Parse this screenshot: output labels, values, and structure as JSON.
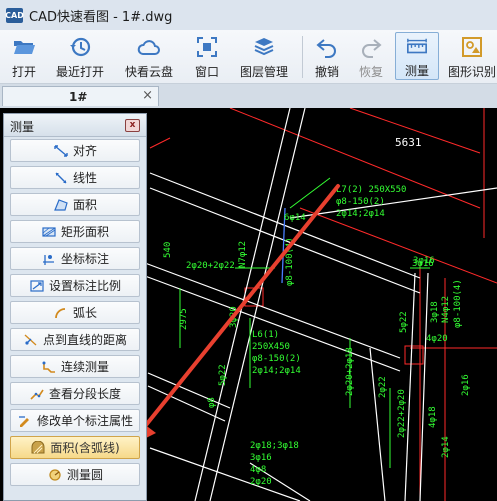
{
  "window": {
    "title": "CAD快速看图 - 1#.dwg",
    "logo_text": "CAD"
  },
  "toolbar": {
    "items": [
      {
        "label": "打开",
        "icon": "folder-open-icon"
      },
      {
        "label": "最近打开",
        "icon": "history-icon"
      },
      {
        "label": "快看云盘",
        "icon": "cloud-icon"
      },
      {
        "label": "窗口",
        "icon": "window-icon"
      },
      {
        "label": "图层管理",
        "icon": "layers-icon"
      },
      {
        "label": "撤销",
        "icon": "undo-icon"
      },
      {
        "label": "恢复",
        "icon": "redo-icon",
        "disabled": true
      },
      {
        "label": "测量",
        "icon": "ruler-icon",
        "active": true
      },
      {
        "label": "图形识别",
        "icon": "shape-recognize-icon"
      }
    ]
  },
  "tabs": [
    {
      "label": "1#",
      "close": "×"
    }
  ],
  "measure_panel": {
    "title": "测量",
    "close": "x",
    "items": [
      {
        "label": "对齐",
        "icon": "align-measure-icon"
      },
      {
        "label": "线性",
        "icon": "linear-measure-icon"
      },
      {
        "label": "面积",
        "icon": "area-icon"
      },
      {
        "label": "矩形面积",
        "icon": "rect-area-icon"
      },
      {
        "label": "坐标标注",
        "icon": "coordinate-icon"
      },
      {
        "label": "设置标注比例",
        "icon": "scale-icon"
      },
      {
        "label": "弧长",
        "icon": "arc-length-icon"
      },
      {
        "label": "点到直线的距离",
        "icon": "point-line-icon"
      },
      {
        "label": "连续测量",
        "icon": "continuous-measure-icon"
      },
      {
        "label": "查看分段长度",
        "icon": "segment-length-icon"
      },
      {
        "label": "修改单个标注属性",
        "icon": "edit-dimension-icon"
      },
      {
        "label": "面积(含弧线)",
        "icon": "arc-area-icon",
        "active": true
      },
      {
        "label": "测量圆",
        "icon": "circle-measure-icon"
      }
    ]
  },
  "drawing": {
    "texts": [
      "5631",
      "L7(2) 250X550",
      "φ8-150(2)",
      "2φ14;2φ14",
      "6φ14",
      "3φ16",
      "N7φ12",
      "φ8-100(4)",
      "2φ20+2φ22",
      "540",
      "2975",
      "L6(1)",
      "250X450",
      "φ8-150(2)",
      "2φ14;2φ14",
      "2φ20+2φ18",
      "3φ16",
      "5φ22",
      "3φ18",
      "N4φ12",
      "φ8-100(4)",
      "4φ20",
      "2φ22+2φ20",
      "4φ18",
      "2φ14",
      "3φ20",
      "φ8",
      "2φ18;3φ18",
      "3φ16",
      "4φ8",
      "2φ20",
      "5φ22",
      "2φ22",
      "2φ16"
    ],
    "colors": {
      "background": "#000000",
      "beam": "#ffffff",
      "axis": "#ff2a2a",
      "rebar": "#33ff33",
      "arrow": "#e8402f",
      "focus": "#4a7fff"
    }
  }
}
